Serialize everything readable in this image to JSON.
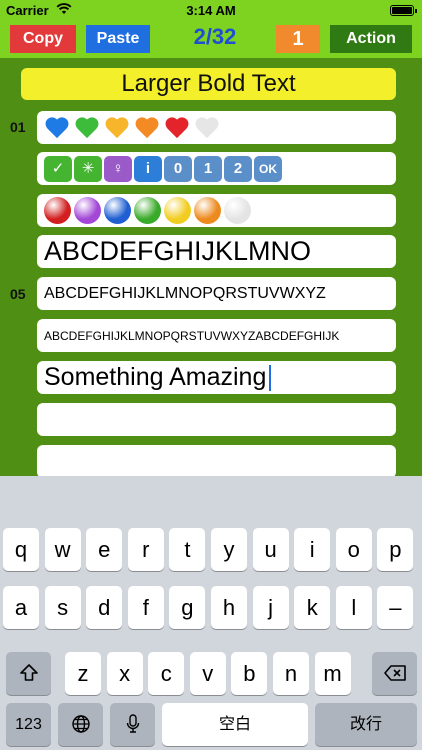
{
  "status": {
    "carrier": "Carrier",
    "time": "3:14 AM"
  },
  "toolbar": {
    "copy": "Copy",
    "paste": "Paste",
    "page": "2/32",
    "count": "1",
    "action": "Action"
  },
  "title": "Larger Bold Text",
  "row_numbers": {
    "first": "01",
    "fifth": "05"
  },
  "rows": {
    "hearts": [
      "#1e7ae5",
      "#3dbb3a",
      "#f7b52b",
      "#f38a23",
      "#e3242b",
      "#e6e6e6"
    ],
    "symbols": [
      {
        "icon": "check-icon",
        "glyph": "✓",
        "color": "#45b431"
      },
      {
        "icon": "sparkle-icon",
        "glyph": "✳",
        "color": "#45b431"
      },
      {
        "icon": "womens-room-icon",
        "glyph": "♀",
        "color": "#9a5bc9"
      },
      {
        "icon": "information-icon",
        "glyph": "i",
        "color": "#2d7ed8"
      },
      {
        "icon": "keycap-zero-icon",
        "glyph": "0",
        "color": "#5b8fc9"
      },
      {
        "icon": "keycap-one-icon",
        "glyph": "1",
        "color": "#5b8fc9"
      },
      {
        "icon": "keycap-two-icon",
        "glyph": "2",
        "color": "#5b8fc9"
      },
      {
        "icon": "ok-icon",
        "glyph": "OK",
        "color": "#5b8fc9"
      }
    ],
    "circles": [
      "#d21f1f",
      "#a347d6",
      "#1f5fd1",
      "#3aaa2a",
      "#f2cd21",
      "#ec8a1e",
      "#e4e4e4"
    ],
    "alpha_large": "ABCDEFGHIJKLMNO",
    "alpha_medium": "ABCDEFGHIJKLMNOPQRSTUVWXYZ",
    "alpha_small": "ABCDEFGHIJKLMNOPQRSTUVWXYZABCDEFGHIJK",
    "input_text": "Something Amazing"
  },
  "keyboard": {
    "row1": [
      "q",
      "w",
      "e",
      "r",
      "t",
      "y",
      "u",
      "i",
      "o",
      "p"
    ],
    "row2": [
      "a",
      "s",
      "d",
      "f",
      "g",
      "h",
      "j",
      "k",
      "l",
      "–"
    ],
    "row3": [
      "z",
      "x",
      "c",
      "v",
      "b",
      "n",
      "m"
    ],
    "numbers": "123",
    "space": "空白",
    "return": "改行"
  }
}
